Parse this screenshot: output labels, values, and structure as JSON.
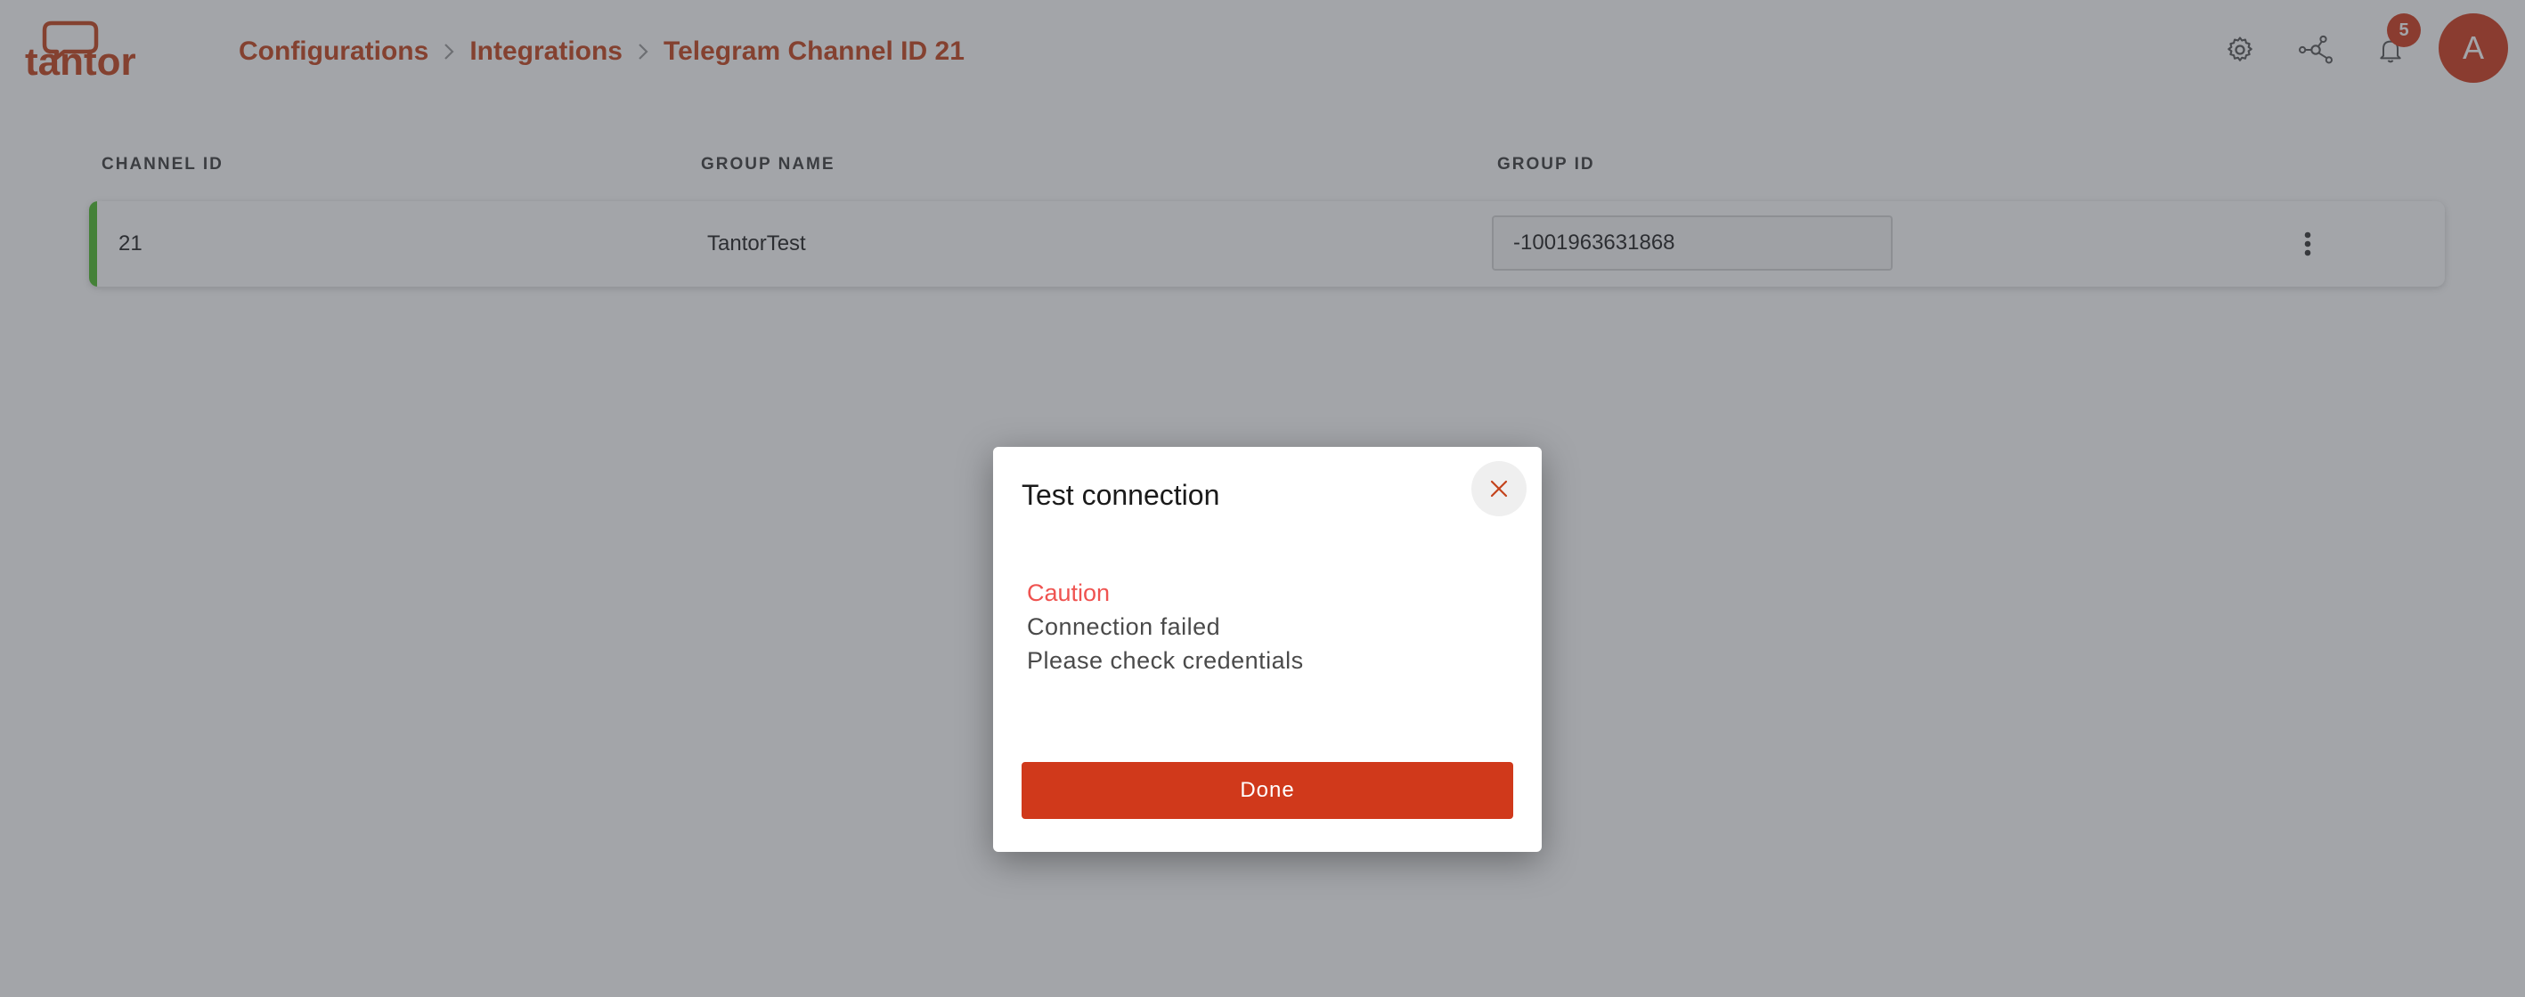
{
  "app": {
    "logo_text": "tantor",
    "brand_color": "#c4431c"
  },
  "breadcrumb": {
    "items": [
      "Configurations",
      "Integrations",
      "Telegram Channel ID 21"
    ]
  },
  "header": {
    "icons": [
      "gear-icon",
      "network-icon",
      "bell-icon"
    ],
    "notification_count": "5",
    "avatar_initial": "A"
  },
  "table": {
    "columns": [
      "CHANNEL ID",
      "GROUP NAME",
      "GROUP ID"
    ],
    "rows": [
      {
        "channel_id": "21",
        "group_name": "TantorTest",
        "group_id": "-1001963631868",
        "status_color": "#4cbb2a"
      }
    ]
  },
  "modal": {
    "title": "Test connection",
    "caution_label": "Caution",
    "message_line1": "Connection failed",
    "message_line2": "Please check credentials",
    "done_label": "Done",
    "accent_color": "#d0391b"
  }
}
